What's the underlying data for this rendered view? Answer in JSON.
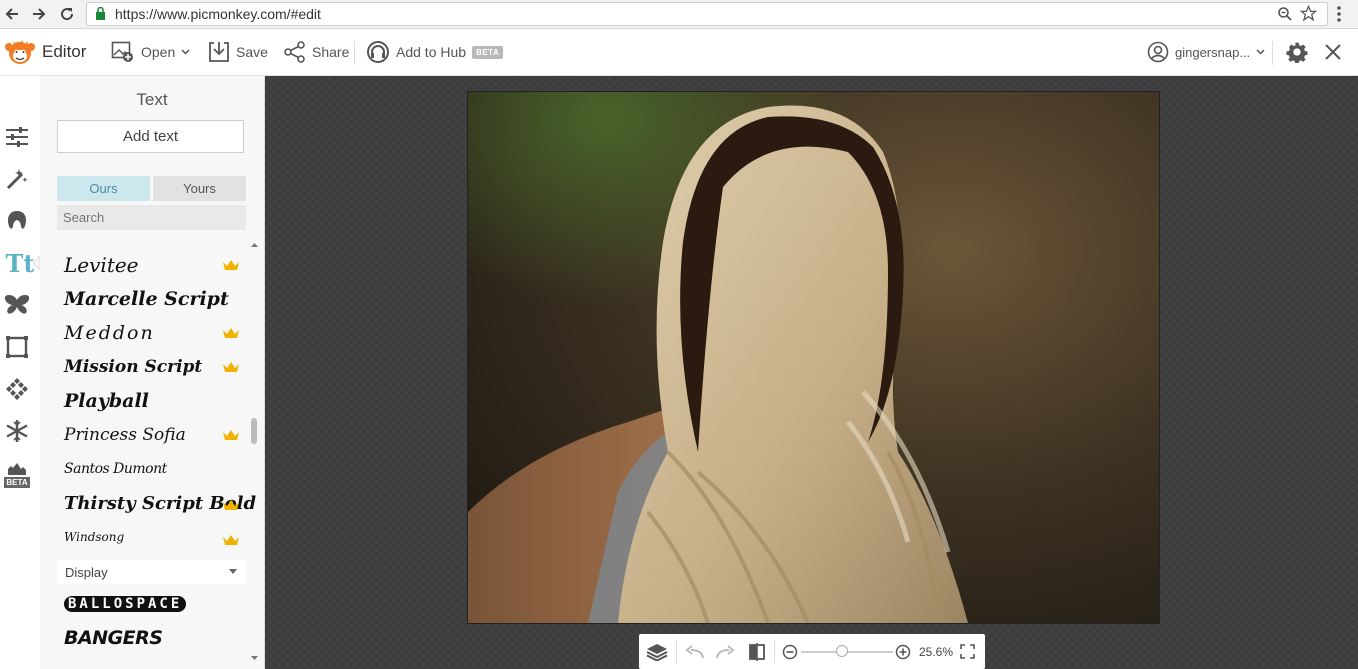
{
  "browser": {
    "url": "https://www.picmonkey.com/#edit",
    "icons": [
      "back-arrow-icon",
      "forward-arrow-icon",
      "reload-icon",
      "lock-icon",
      "zoom-icon",
      "star-icon",
      "menu-dots-icon"
    ]
  },
  "toolbar": {
    "brand": "Editor",
    "open_label": "Open",
    "save_label": "Save",
    "share_label": "Share",
    "hub_label": "Add to Hub",
    "hub_badge": "BETA",
    "user_label": "gingersnap..."
  },
  "rail": {
    "items": [
      "basic-edits",
      "effects",
      "touch-up",
      "text",
      "overlays",
      "frames",
      "textures",
      "themes",
      "beta-tools"
    ],
    "active": "text",
    "beta_label": "BETA"
  },
  "panel": {
    "title": "Text",
    "add_text_label": "Add text",
    "tabs": [
      {
        "label": "Ours",
        "active": true
      },
      {
        "label": "Yours",
        "active": false
      }
    ],
    "search_placeholder": "Search",
    "fonts": [
      {
        "name": "Levitee",
        "premium": true
      },
      {
        "name": "Marcelle Script",
        "premium": false
      },
      {
        "name": "Meddon",
        "premium": true
      },
      {
        "name": "Mission Script",
        "premium": true
      },
      {
        "name": "Playball",
        "premium": false
      },
      {
        "name": "Princess Sofia",
        "premium": true
      },
      {
        "name": "Santos Dumont",
        "premium": false
      },
      {
        "name": "Thirsty Script Bold",
        "premium": true
      },
      {
        "name": "Windsong",
        "premium": true
      }
    ],
    "category_select": "Display",
    "display_fonts": [
      "BALLOSPACE",
      "BANGERS"
    ]
  },
  "zoom": {
    "value": "25.6%",
    "slider_position": 0.45
  },
  "colors": {
    "accent": "#5ab4c5",
    "brand": "#f27d26",
    "crown": "#f0b400",
    "canvas_bg": "#3f3f3f"
  }
}
